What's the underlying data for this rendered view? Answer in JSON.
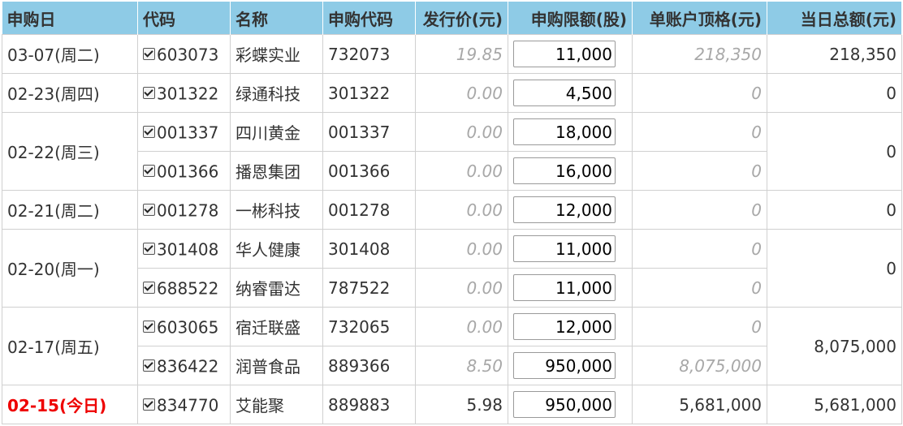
{
  "headers": {
    "date": "申购日",
    "code": "代码",
    "name": "名称",
    "sub_code": "申购代码",
    "price": "发行价(元)",
    "limit": "申购限额(股)",
    "quota": "单账户顶格(元)",
    "total": "当日总额(元)"
  },
  "groups": [
    {
      "date": "03-07(周二)",
      "total": "218,350",
      "rows": [
        {
          "code": "603073",
          "name": "彩蝶实业",
          "sub_code": "732073",
          "price": "19.85",
          "limit": "11,000",
          "quota": "218,350"
        }
      ]
    },
    {
      "date": "02-23(周四)",
      "total": "0",
      "rows": [
        {
          "code": "301322",
          "name": "绿通科技",
          "sub_code": "301322",
          "price": "0.00",
          "limit": "4,500",
          "quota": "0"
        }
      ]
    },
    {
      "date": "02-22(周三)",
      "total": "0",
      "rows": [
        {
          "code": "001337",
          "name": "四川黄金",
          "sub_code": "001337",
          "price": "0.00",
          "limit": "18,000",
          "quota": "0"
        },
        {
          "code": "001366",
          "name": "播恩集团",
          "sub_code": "001366",
          "price": "0.00",
          "limit": "16,000",
          "quota": "0"
        }
      ]
    },
    {
      "date": "02-21(周二)",
      "total": "0",
      "rows": [
        {
          "code": "001278",
          "name": "一彬科技",
          "sub_code": "001278",
          "price": "0.00",
          "limit": "12,000",
          "quota": "0"
        }
      ]
    },
    {
      "date": "02-20(周一)",
      "total": "0",
      "rows": [
        {
          "code": "301408",
          "name": "华人健康",
          "sub_code": "301408",
          "price": "0.00",
          "limit": "11,000",
          "quota": "0"
        },
        {
          "code": "688522",
          "name": "纳睿雷达",
          "sub_code": "787522",
          "price": "0.00",
          "limit": "11,000",
          "quota": "0"
        }
      ]
    },
    {
      "date": "02-17(周五)",
      "total": "8,075,000",
      "rows": [
        {
          "code": "603065",
          "name": "宿迁联盛",
          "sub_code": "732065",
          "price": "0.00",
          "limit": "12,000",
          "quota": "0"
        },
        {
          "code": "836422",
          "name": "润普食品",
          "sub_code": "889366",
          "price": "8.50",
          "limit": "950,000",
          "quota": "8,075,000"
        }
      ]
    },
    {
      "date": "02-15(今日)",
      "today": true,
      "total": "5,681,000",
      "rows": [
        {
          "code": "834770",
          "name": "艾能聚",
          "sub_code": "889883",
          "price": "5.98",
          "limit": "950,000",
          "quota": "5,681,000",
          "current": true
        }
      ]
    }
  ],
  "colors": {
    "header_bg": "#8ecbe6",
    "today_text": "#ee0000",
    "dim_text": "#a8a8a8"
  },
  "icons": {
    "checkbox": "checkbox-checked-icon"
  }
}
